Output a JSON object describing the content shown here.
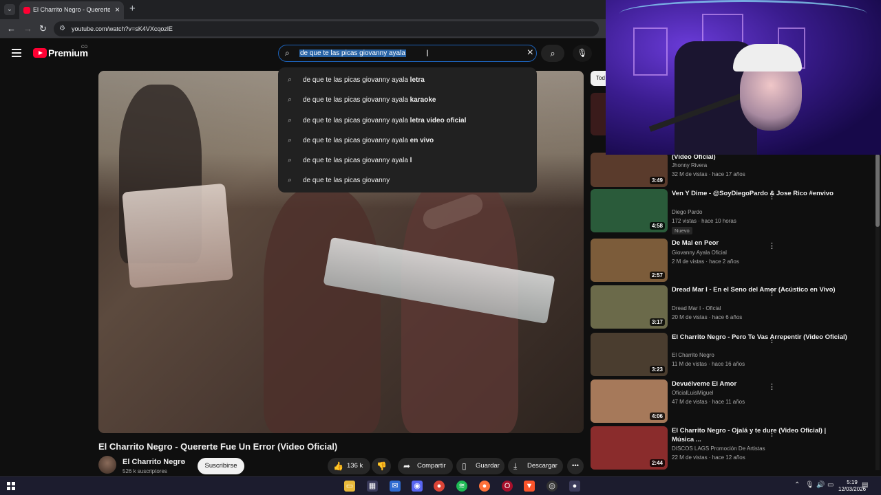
{
  "browser": {
    "tab_title": "El Charrito Negro - Quererte Fu",
    "url": "youtube.com/watch?v=sK4VXcqozlE"
  },
  "header": {
    "logo_text": "Premium",
    "region": "CO",
    "search_query": "de que te las picas giovanny ayala"
  },
  "suggestions": [
    {
      "base": "de que te las picas giovanny ayala",
      "bold": " letra"
    },
    {
      "base": "de que te las picas giovanny ayala",
      "bold": " karaoke"
    },
    {
      "base": "de que te las picas giovanny ayala",
      "bold": " letra video oficial"
    },
    {
      "base": "de que te las picas giovanny ayala",
      "bold": " en vivo"
    },
    {
      "base": "de que te las picas giovanny ayala",
      "bold": " l"
    },
    {
      "base": "de que te las picas giovanny",
      "bold": ""
    }
  ],
  "video": {
    "title": "El Charrito Negro - Quererte Fue Un Error (Video Oficial)",
    "channel": "El Charrito Negro",
    "subscribers": "526 k suscriptores",
    "subscribe_label": "Suscribirse",
    "likes": "136 k",
    "share_label": "Compartir",
    "save_label": "Guardar",
    "download_label": "Descargar"
  },
  "sidebar": {
    "chip": "Tod",
    "recs": [
      {
        "title": "(Video Oficial)",
        "channel": "Jhonny Rivera",
        "meta": "32 M de vistas · hace 17 años",
        "duration": "3:49",
        "color": "#5a3b2c"
      },
      {
        "title": "Ven Y Dime - @SoyDiegoPardo & Jose Rico #envivo",
        "channel": "Diego Pardo",
        "meta": "172 vistas · hace 10 horas",
        "duration": "4:58",
        "badge": "Nuevo",
        "color": "#2a5b3a"
      },
      {
        "title": "De Mal en Peor",
        "channel": "Giovanny Ayala Oficial",
        "meta": "2 M de vistas · hace 2 años",
        "duration": "2:57",
        "color": "#7c5c3a"
      },
      {
        "title": "Dread Mar I - En el Seno del Amor (Acústico en Vivo)",
        "channel": "Dread Mar I - Oficial",
        "meta": "20 M de vistas · hace 6 años",
        "duration": "3:17",
        "color": "#6b6a4a"
      },
      {
        "title": "El Charrito Negro - Pero Te Vas Arrepentir (Video Oficial)",
        "channel": "El Charrito Negro",
        "meta": "11 M de vistas · hace 16 años",
        "duration": "3:23",
        "color": "#4a3d2f"
      },
      {
        "title": "Devuélveme El Amor",
        "channel": "OficialLuisMiguel",
        "meta": "47 M de vistas · hace 11 años",
        "duration": "4:06",
        "color": "#a6795a"
      },
      {
        "title": "El Charrito Negro - Ojalá y te dure (Video Oficial) | Música ...",
        "channel": "DISCOS LAGS Promoción De Artistas",
        "meta": "22 M de vistas · hace 12 años",
        "duration": "2:44",
        "color": "#8a2c2c"
      }
    ]
  },
  "taskbar": {
    "time": "5:19",
    "date": "12/03/2026"
  },
  "colors": {
    "accent_blue": "#1c62b9",
    "yt_red": "#ff0033"
  }
}
